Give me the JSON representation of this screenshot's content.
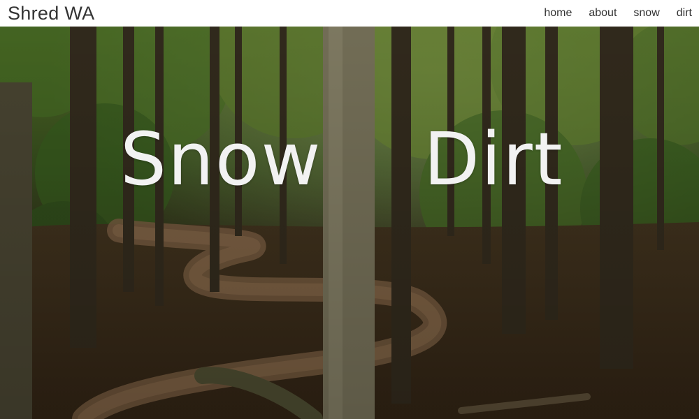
{
  "header": {
    "brand": "Shred WA",
    "nav": [
      {
        "label": "home"
      },
      {
        "label": "about"
      },
      {
        "label": "snow"
      },
      {
        "label": "dirt"
      }
    ]
  },
  "hero": {
    "words": [
      "Snow",
      "Dirt"
    ],
    "image_description": "forest-trail-photo"
  },
  "colors": {
    "header_bg": "#ffffff",
    "header_text": "#333333",
    "hero_text": "#f2f2f2"
  }
}
